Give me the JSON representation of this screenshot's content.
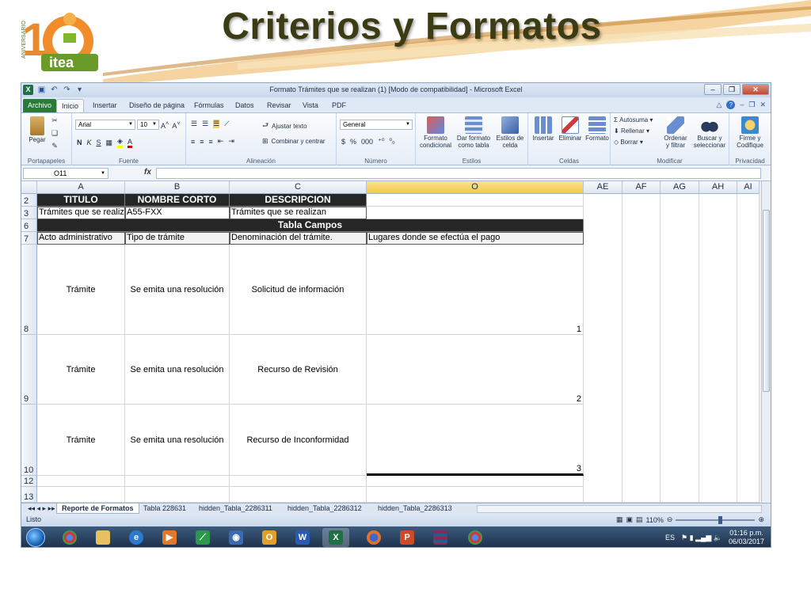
{
  "slide": {
    "title": "Criterios y Formatos",
    "logo_text": "itea",
    "logo_sub": "ANIVERSARIO",
    "logo_num": "10"
  },
  "window": {
    "title": "Formato Trámites que se realizan (1)  [Modo de compatibilidad]  -  Microsoft Excel"
  },
  "tabs": [
    "Archivo",
    "Inicio",
    "Insertar",
    "Diseño de página",
    "Fórmulas",
    "Datos",
    "Revisar",
    "Vista",
    "PDF"
  ],
  "ribbon": {
    "pegar": "Pegar",
    "font_name": "Arial",
    "font_size": "10",
    "ajustar": "Ajustar texto",
    "combinar": "Combinar y centrar",
    "number_format": "General",
    "formato_cond_1": "Formato",
    "formato_cond_2": "condicional",
    "dar_formato_1": "Dar formato",
    "dar_formato_2": "como tabla",
    "estilos_1": "Estilos de",
    "estilos_2": "celda",
    "insertar": "Insertar",
    "eliminar": "Eliminar",
    "formato": "Formato",
    "autosuma": "Autosuma",
    "rellenar": "Rellenar",
    "borrar": "Borrar",
    "ordenar_1": "Ordenar",
    "ordenar_2": "y filtrar",
    "buscar_1": "Buscar y",
    "buscar_2": "seleccionar",
    "firme_1": "Firme y",
    "firme_2": "Codifique",
    "groups": [
      "Portapapeles",
      "Fuente",
      "Alineación",
      "Número",
      "Estilos",
      "Celdas",
      "Modificar",
      "Privacidad"
    ]
  },
  "formula_bar": {
    "name_box": "O11",
    "fx": "fx",
    "value": ""
  },
  "columns": [
    "A",
    "B",
    "C",
    "O",
    "AE",
    "AF",
    "AG",
    "AH",
    "AI"
  ],
  "rows": [
    "2",
    "3",
    "6",
    "7",
    "8",
    "9",
    "10",
    "12",
    "13"
  ],
  "sheet": {
    "r2": [
      "TITULO",
      "NOMBRE CORTO",
      "DESCRIPCION"
    ],
    "r3": [
      "Trámites que se realizan",
      "A55-FXX",
      "Trámites que se realizan"
    ],
    "r6": "Tabla Campos",
    "r7": [
      "Acto administrativo",
      "Tipo de trámite",
      "Denominación del trámite.",
      "Lugares donde se efectúa el pago"
    ],
    "r8": [
      "Trámite",
      "Se emita una resolución",
      "Solicitud de información",
      "1"
    ],
    "r9": [
      "Trámite",
      "Se emita una resolución",
      "Recurso de Revisión",
      "2"
    ],
    "r10": [
      "Trámite",
      "Se emita una resolución",
      "Recurso de Inconformidad",
      "3"
    ]
  },
  "sheet_tabs": [
    "Reporte de Formatos",
    "Tabla 228631",
    "hidden_Tabla_2286311",
    "hidden_Tabla_2286312",
    "hidden_Tabla_2286313"
  ],
  "status": {
    "mode": "Listo",
    "zoom": "110%"
  },
  "tray": {
    "lang": "ES",
    "time": "01:16 p.m.",
    "date": "06/03/2017"
  },
  "colors": {
    "accent_green": "#2a7a3a",
    "header_dark": "#262626",
    "selected_col": "#f2c94c",
    "title": "#3b3b14"
  }
}
